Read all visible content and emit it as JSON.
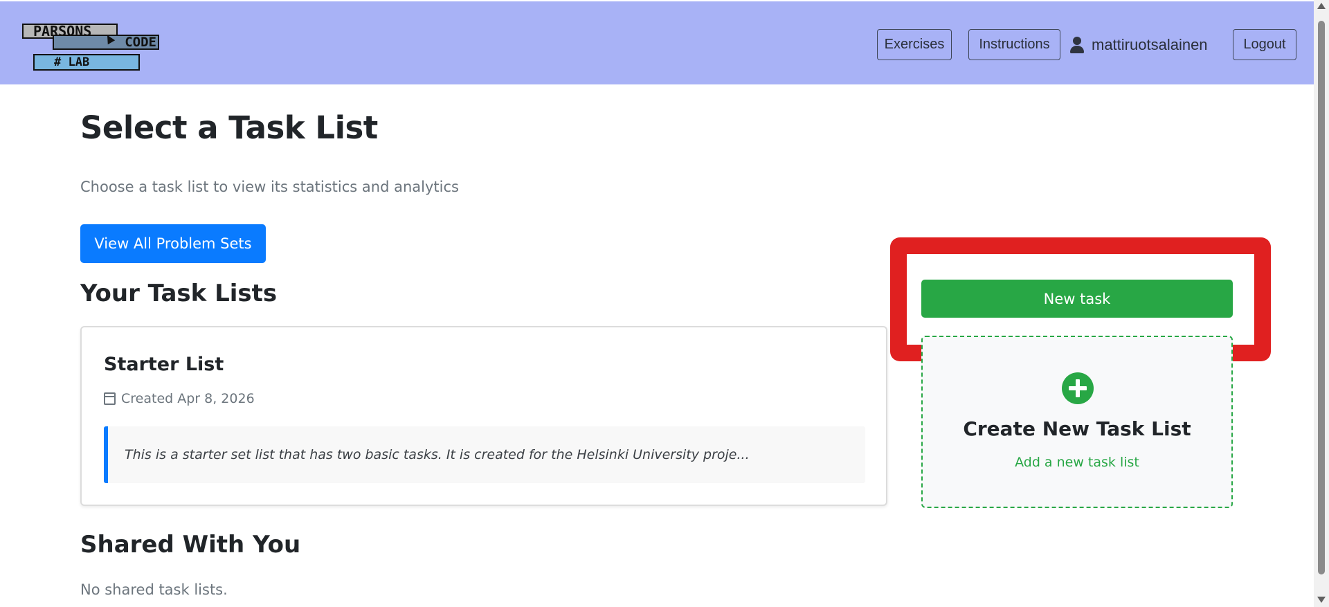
{
  "header": {
    "logo": {
      "line1": "PARSONS",
      "line2": "CODE",
      "line3": "# LAB"
    },
    "exercises_label": "Exercises",
    "instructions_label": "Instructions",
    "username": "mattiruotsalainen",
    "logout_label": "Logout",
    "background_color": "#a8b2f6"
  },
  "main": {
    "title": "Select a Task List",
    "subtitle": "Choose a task list to view its statistics and analytics",
    "view_all_label": "View All Problem Sets",
    "your_lists_heading": "Your Task Lists",
    "task_lists": [
      {
        "name": "Starter List",
        "created": "Created Apr 8, 2026",
        "description": "This is a starter set list that has two basic tasks. It is created for the Helsinki University proje..."
      }
    ],
    "shared_heading": "Shared With You",
    "shared_empty": "No shared task lists."
  },
  "sidebar": {
    "new_task_label": "New task",
    "create_title": "Create New Task List",
    "create_subtitle": "Add a new task list"
  },
  "icons": [
    "user-icon",
    "calendar-icon",
    "plus-circle-icon"
  ],
  "colors": {
    "primary": "#0a7bff",
    "success": "#28a745",
    "highlight": "#e02020",
    "muted": "#6c757d"
  }
}
